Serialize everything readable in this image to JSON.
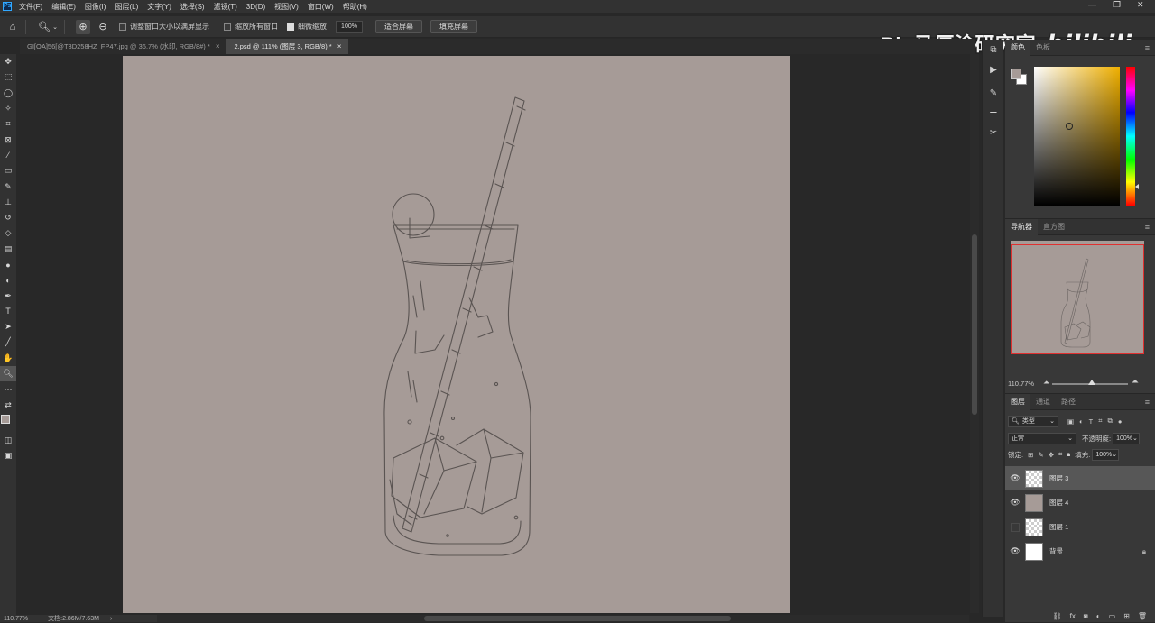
{
  "menu": [
    "文件(F)",
    "编辑(E)",
    "图像(I)",
    "图层(L)",
    "文字(Y)",
    "选择(S)",
    "滤镜(T)",
    "3D(D)",
    "视图(V)",
    "窗口(W)",
    "帮助(H)"
  ],
  "options": {
    "resize_windows": "调整窗口大小以满屏显示",
    "zoom_all": "缩放所有窗口",
    "scrubby_zoom": "细微缩放",
    "zoom_value": "100%",
    "fit_screen": "适合屏幕",
    "fill_screen": "填充屏幕"
  },
  "watermark": {
    "text": "Big马厚涂研究室",
    "logo": "bilibili"
  },
  "tabs": [
    {
      "label": "GI[OA]56[@T3D258HZ_FP47.jpg @ 36.7% (水印, RGB/8#) *",
      "active": false
    },
    {
      "label": "2.psd @ 111% (图层 3, RGB/8) *",
      "active": true
    }
  ],
  "color_panel": {
    "tab_color": "颜色",
    "tab_swatches": "色板"
  },
  "navigator": {
    "tab_navigator": "导航器",
    "tab_histogram": "直方图",
    "zoom": "110.77%"
  },
  "layers_panel": {
    "tab_layers": "图层",
    "tab_channels": "通道",
    "tab_paths": "路径",
    "filter": "类型",
    "blend_mode": "正常",
    "opacity_label": "不透明度:",
    "opacity": "100%",
    "lock_label": "锁定:",
    "fill_label": "填充:",
    "fill": "100%",
    "layers": [
      {
        "name": "图层 3",
        "visible": true,
        "selected": true
      },
      {
        "name": "图层 4",
        "visible": true,
        "selected": false
      },
      {
        "name": "图层 1",
        "visible": false,
        "selected": false
      },
      {
        "name": "背景",
        "visible": true,
        "selected": false,
        "locked": true
      }
    ]
  },
  "status": {
    "zoom": "110.77%",
    "doc_size": "文档:2.86M/7.63M"
  },
  "colors": {
    "canvas": "#a69b97",
    "ui_dark": "#323232",
    "selection": "#575757",
    "nav_frame": "#e03030"
  }
}
